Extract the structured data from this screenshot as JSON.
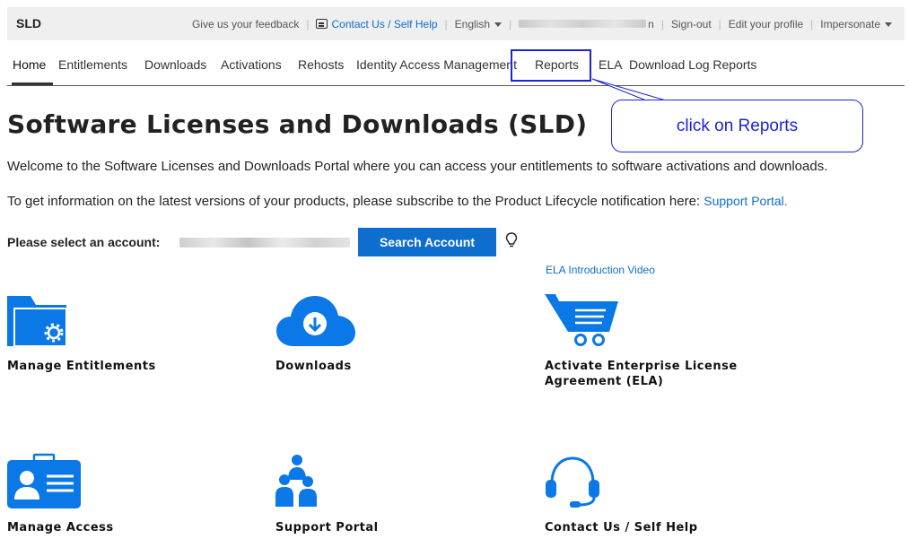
{
  "brand": "SLD",
  "topbar": {
    "feedback": "Give us your feedback",
    "contact": "Contact Us / Self Help",
    "language": "English",
    "user_suffix": "n",
    "signout": "Sign-out",
    "edit_profile": "Edit your profile",
    "impersonate": "Impersonate"
  },
  "nav": {
    "items": [
      "Home",
      "Entitlements",
      "Downloads",
      "Activations",
      "Rehosts",
      "Identity Access Management",
      "Reports",
      "ELA",
      "Download Log Reports"
    ],
    "active": "Home"
  },
  "callout": {
    "text": "click on Reports"
  },
  "page": {
    "title": "Software Licenses and Downloads (SLD)",
    "welcome": "Welcome to the Software Licenses and Downloads Portal where you can access your entitlements to software activations and downloads.",
    "info": "To get information on the latest versions of your products, please subscribe to the Product Lifecycle notification here: ",
    "info_link": "Support Portal."
  },
  "account": {
    "label": "Please select an account:",
    "search_button": "Search Account"
  },
  "ela_video": "ELA Introduction Video",
  "tiles": [
    {
      "label": "Manage Entitlements",
      "icon": "folder-gear-icon"
    },
    {
      "label": "Downloads",
      "icon": "cloud-download-icon"
    },
    {
      "label": "Activate Enterprise License Agreement (ELA)",
      "icon": "cart-icon"
    },
    {
      "label": "Manage Access",
      "icon": "id-badge-icon"
    },
    {
      "label": "Support Portal",
      "icon": "people-icon"
    },
    {
      "label": "Contact Us / Self Help",
      "icon": "headset-icon"
    }
  ],
  "colors": {
    "accent": "#0e6ecd",
    "icon_blue": "#0a78e6",
    "annotation": "#1d25d0",
    "topbar_bg": "#efefef"
  }
}
